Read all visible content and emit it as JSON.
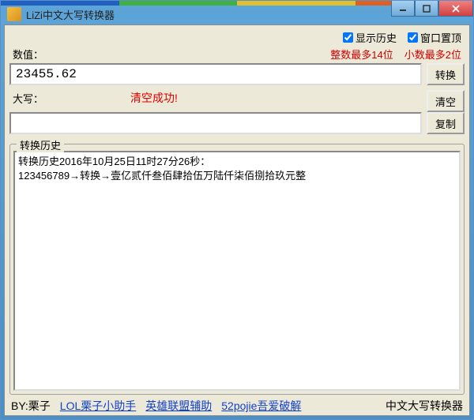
{
  "titlebar": {
    "icon_text": "中文大写",
    "title": "LiZi中文大写转换器"
  },
  "options": {
    "show_history_label": "显示历史",
    "show_history_checked": true,
    "always_on_top_label": "窗口置顶",
    "always_on_top_checked": true
  },
  "labels": {
    "value": "数值：",
    "hint_int": "整数最多14位",
    "hint_dec": "小数最多2位",
    "daxie": "大写：",
    "history_group": "转换历史"
  },
  "buttons": {
    "convert": "转换",
    "clear": "清空",
    "copy": "复制"
  },
  "input": {
    "value": "23455.62"
  },
  "output": {
    "value": ""
  },
  "status_message": "清空成功!",
  "history_text": "转换历史2016年10月25日11时27分26秒：\n123456789→转换→壹亿贰仟叁佰肆拾伍万陆仟柒佰捌拾玖元整",
  "footer": {
    "by_label": "BY:栗子",
    "link1": "LOL栗子小助手",
    "link2": "英雄联盟辅助",
    "link3": "52pojie吾爱破解",
    "app_name": "中文大写转换器"
  },
  "accent_colors": [
    "#2060c0",
    "#40b040",
    "#e0c030",
    "#e06020"
  ]
}
